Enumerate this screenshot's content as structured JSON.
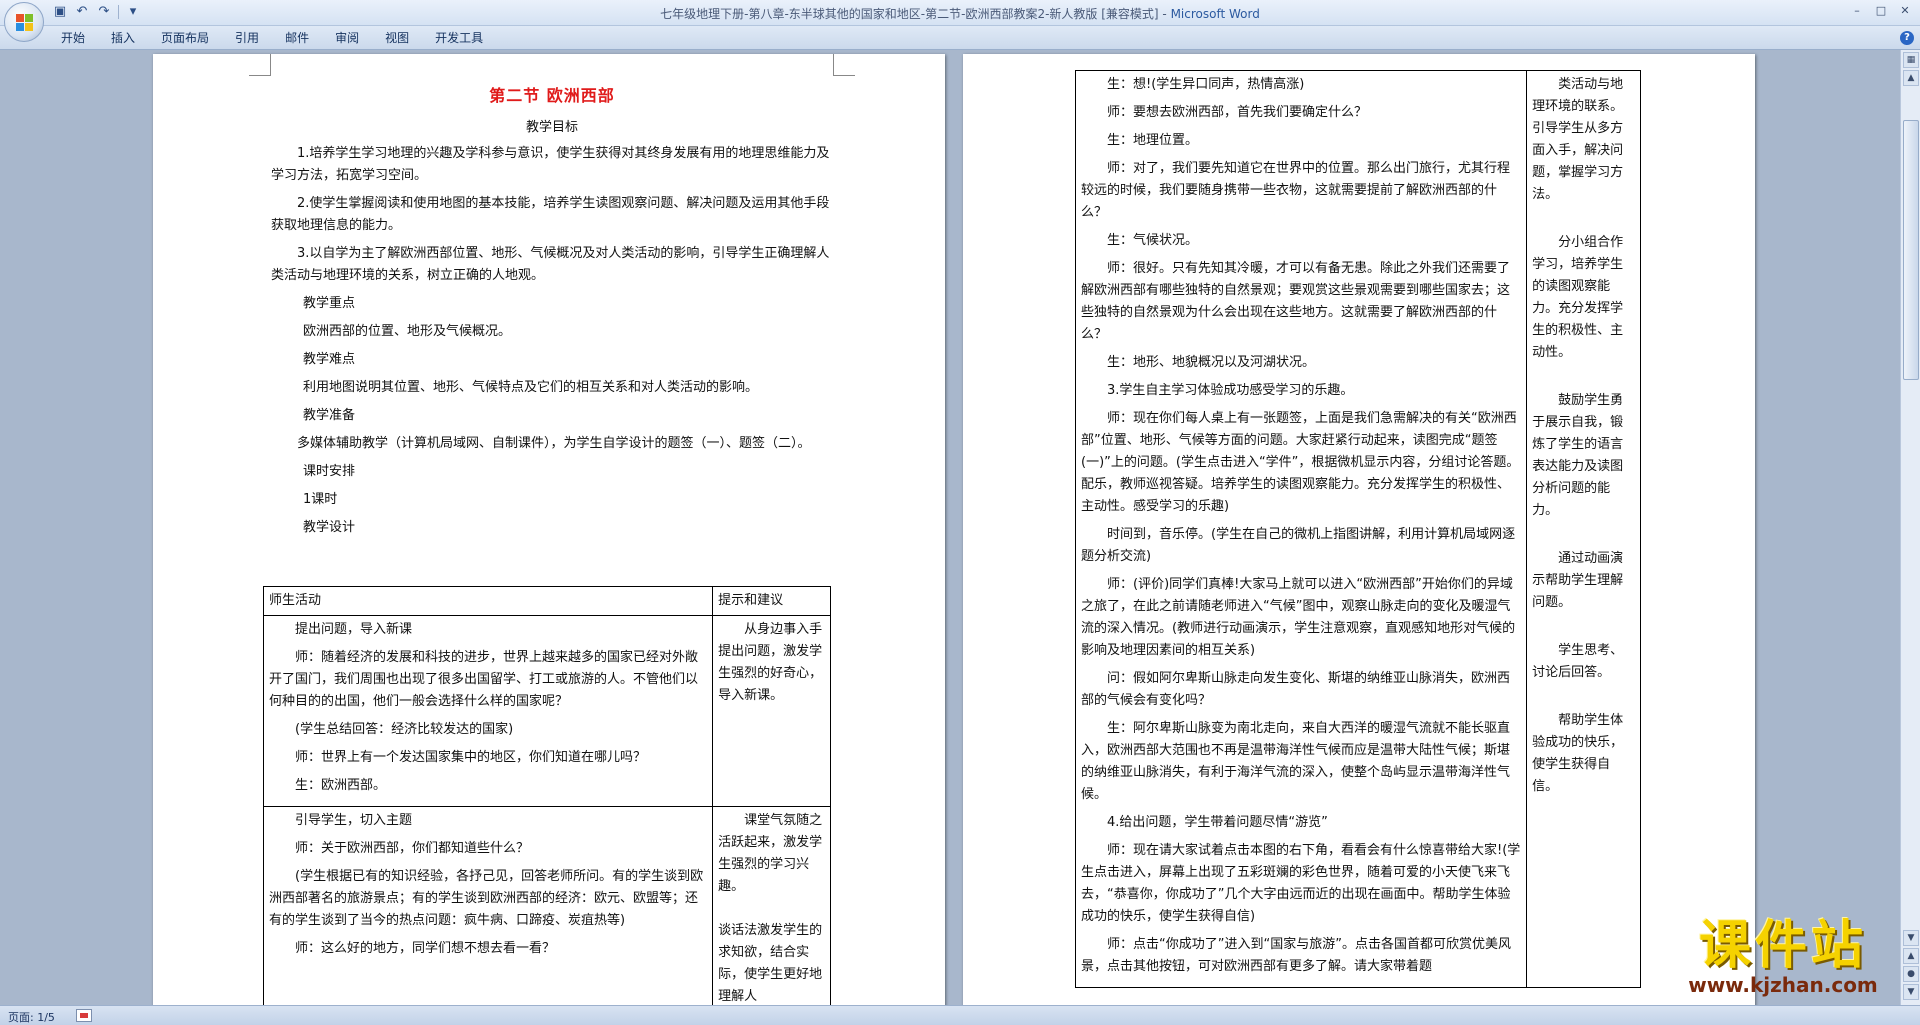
{
  "window": {
    "title": "七年级地理下册-第八章-东半球其他的国家和地区-第二节-欧洲西部教案2-新人教版 [兼容模式] - ",
    "app_name": "Microsoft Word",
    "controls": [
      "–",
      "□",
      "✕"
    ]
  },
  "ribbon": {
    "tabs": [
      "开始",
      "插入",
      "页面布局",
      "引用",
      "邮件",
      "审阅",
      "视图",
      "开发工具"
    ],
    "help": "?"
  },
  "page1": {
    "section_title": "第二节  欧洲西部",
    "goals_heading": "教学目标",
    "goals": [
      "1.培养学生学习地理的兴趣及学科参与意识，使学生获得对其终身发展有用的地理思维能力及学习方法，拓宽学习空间。",
      "2.使学生掌握阅读和使用地图的基本技能，培养学生读图观察问题、解决问题及运用其他手段获取地理信息的能力。",
      "3.以自学为主了解欧洲西部位置、地形、气候概况及对人类活动的影响，引导学生正确理解人类活动与地理环境的关系，树立正确的人地观。"
    ],
    "key_heading": "教学重点",
    "key_text": "欧洲西部的位置、地形及气候概况。",
    "difficulty_heading": "教学难点",
    "difficulty_text": "利用地图说明其位置、地形、气候特点及它们的相互关系和对人类活动的影响。",
    "prep_heading": "教学准备",
    "prep_text": "多媒体辅助教学（计算机局域网、自制课件），为学生自学设计的题签（一）、题签（二）。",
    "schedule_heading": "课时安排",
    "schedule_text": "1课时",
    "design_heading": "教学设计",
    "table": {
      "header_activity": "师生活动",
      "header_tips": "提示和建议",
      "rows": [
        {
          "activity": [
            {
              "style": "s",
              "text": "提出问题，导入新课"
            },
            {
              "style": "p",
              "text": "师：随着经济的发展和科技的进步，世界上越来越多的国家已经对外敞开了国门，我们周围也出现了很多出国留学、打工或旅游的人。不管他们以何种目的的出国，他们一般会选择什么样的国家呢？"
            },
            {
              "style": "s",
              "text": "(学生总结回答：经济比较发达的国家)"
            },
            {
              "style": "s",
              "text": "师：世界上有一个发达国家集中的地区，你们知道在哪儿吗？"
            },
            {
              "style": "s",
              "text": "生：欧洲西部。"
            }
          ],
          "tip": "从身边事入手提出问题，激发学生强烈的好奇心，导入新课。"
        },
        {
          "activity": [
            {
              "style": "s",
              "text": "引导学生，切入主题"
            },
            {
              "style": "s",
              "text": "师：关于欧洲西部，你们都知道些什么？"
            },
            {
              "style": "p",
              "text": "(学生根据已有的知识经验，各抒己见，回答老师所问。有的学生谈到欧洲西部著名的旅游景点；有的学生谈到欧洲西部的经济：欧元、欧盟等；还有的学生谈到了当今的热点问题：疯牛病、口蹄疫、炭疽热等)"
            },
            {
              "style": "s",
              "text": "师：这么好的地方，同学们想不想去看一看？"
            }
          ],
          "tip": "课堂气氛随之活跃起来，激发学生强烈的学习兴趣。\n\n谈话法激发学生的求知欲，结合实际，使学生更好地理解人"
        }
      ]
    }
  },
  "page2": {
    "activity": [
      {
        "style": "s",
        "text": "生：想!(学生异口同声，热情高涨)"
      },
      {
        "style": "s",
        "text": "师：要想去欧洲西部，首先我们要确定什么？"
      },
      {
        "style": "s",
        "text": "生：地理位置。"
      },
      {
        "style": "p",
        "text": "师：对了，我们要先知道它在世界中的位置。那么出门旅行，尤其行程较远的时候，我们要随身携带一些衣物，这就需要提前了解欧洲西部的什么？"
      },
      {
        "style": "s",
        "text": "生：气候状况。"
      },
      {
        "style": "p",
        "text": "师：很好。只有先知其冷暖，才可以有备无患。除此之外我们还需要了解欧洲西部有哪些独特的自然景观；要观赏这些景观需要到哪些国家去；这些独特的自然景观为什么会出现在这些地方。这就需要了解欧洲西部的什么？"
      },
      {
        "style": "s",
        "text": "生：地形、地貌概况以及河湖状况。"
      },
      {
        "style": "s",
        "text": "3.学生自主学习体验成功感受学习的乐趣。"
      },
      {
        "style": "p",
        "text": "师：现在你们每人桌上有一张题签，上面是我们急需解决的有关“欧洲西部”位置、地形、气候等方面的问题。大家赶紧行动起来，读图完成“题签(一)”上的问题。(学生点击进入“学件”，根据微机显示内容，分组讨论答题。配乐，教师巡视答疑。培养学生的读图观察能力。充分发挥学生的积极性、主动性。感受学习的乐趣)"
      },
      {
        "style": "p",
        "text": "时间到，音乐停。(学生在自己的微机上指图讲解，利用计算机局域网逐题分析交流)"
      },
      {
        "style": "p",
        "text": "师：(评价)同学们真棒!大家马上就可以进入“欧洲西部”开始你们的异域之旅了，在此之前请随老师进入“气候”图中，观察山脉走向的变化及暖湿气流的深入情况。(教师进行动画演示，学生注意观察，直观感知地形对气候的影响及地理因素间的相互关系)"
      },
      {
        "style": "p",
        "text": "问：假如阿尔卑斯山脉走向发生变化、斯堪的纳维亚山脉消失，欧洲西部的气候会有变化吗？"
      },
      {
        "style": "p",
        "text": "生：阿尔卑斯山脉变为南北走向，来自大西洋的暖湿气流就不能长驱直入，欧洲西部大范围也不再是温带海洋性气候而应是温带大陆性气候；斯堪的纳维亚山脉消失，有利于海洋气流的深入，使整个岛屿显示温带海洋性气候。"
      },
      {
        "style": "s",
        "text": "4.给出问题，学生带着问题尽情“游览”"
      },
      {
        "style": "p",
        "text": "师：现在请大家试着点击本图的右下角，看看会有什么惊喜带给大家!(学生点击进入，屏幕上出现了五彩斑斓的彩色世界，随着可爱的小天使飞来飞去，“恭喜你，你成功了”几个大字由远而近的出现在画面中。帮助学生体验成功的快乐，使学生获得自信)"
      },
      {
        "style": "p",
        "text": "师：点击“你成功了”进入到“国家与旅游”。点击各国首都可欣赏优美风景，点击其他按钮，可对欧洲西部有更多了解。请大家带着题"
      }
    ],
    "tips": [
      "类活动与地理环境的联系。引导学生从多方面入手，解决问题，掌握学习方法。",
      "分小组合作学习，培养学生的读图观察能力。充分发挥学生的积极性、主动性。",
      "鼓励学生勇于展示自我，锻炼了学生的语言表达能力及读图分析问题的能力。",
      "通过动画演示帮助学生理解问题。",
      "学生思考、讨论后回答。",
      "帮助学生体验成功的快乐，使学生获得自信。"
    ]
  },
  "statusbar": {
    "page": "页面: 1/5"
  },
  "watermark": {
    "title": "课件站",
    "url": "www.kjzhan.com"
  }
}
